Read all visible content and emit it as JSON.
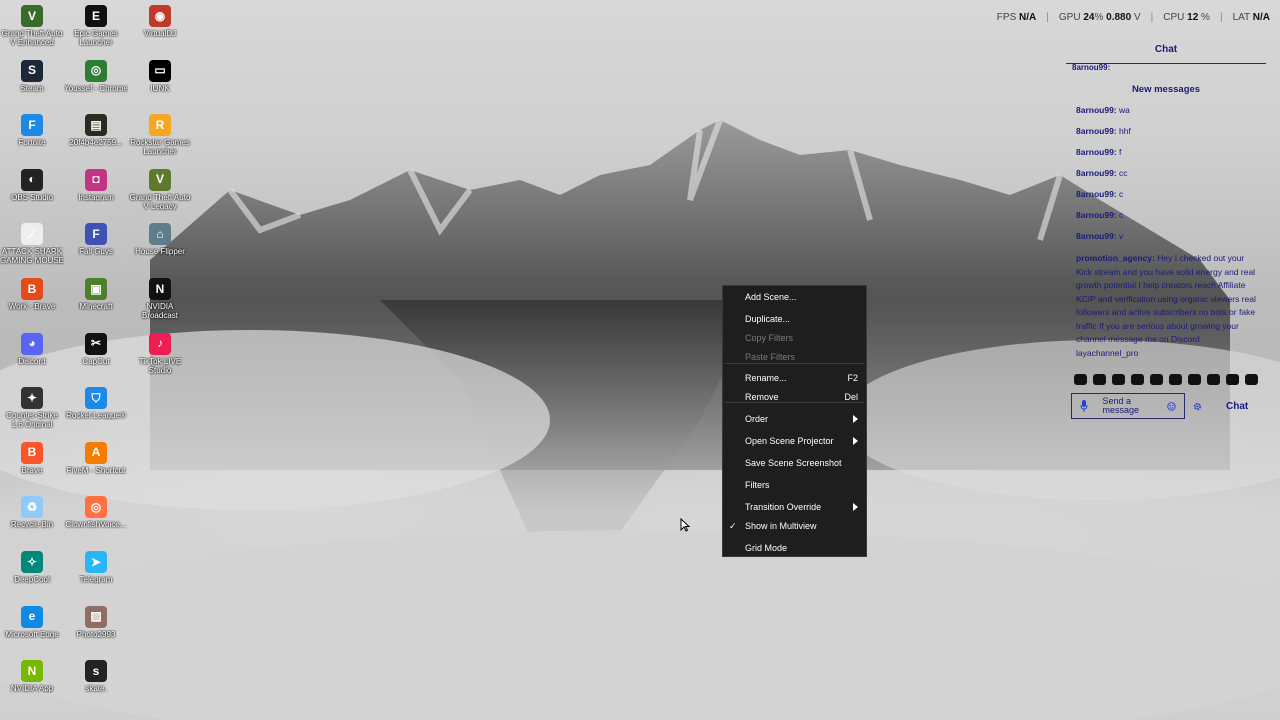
{
  "desktop_icons": [
    {
      "label": "Grand Theft Auto V Enhanced",
      "icon": "gta-icon",
      "color": "#3a6b2a",
      "glyph": "V"
    },
    {
      "label": "Epic Games Launcher",
      "icon": "epic-games-icon",
      "color": "#111111",
      "glyph": "E"
    },
    {
      "label": "VirtualDJ",
      "icon": "virtualdj-icon",
      "color": "#c0392b",
      "glyph": "◉"
    },
    {
      "label": "Steam",
      "icon": "steam-icon",
      "color": "#1b2838",
      "glyph": "S"
    },
    {
      "label": "Youssef - Chrome",
      "icon": "chrome-icon",
      "color": "#2e7d32",
      "glyph": "◎"
    },
    {
      "label": "IUNK",
      "icon": "monitor-icon",
      "color": "#000000",
      "glyph": "▭"
    },
    {
      "label": "Fortnite",
      "icon": "fortnite-icon",
      "color": "#1e88e5",
      "glyph": "F"
    },
    {
      "label": "20f4b4e2759...",
      "icon": "file-icon",
      "color": "#2b2b1f",
      "glyph": "▤"
    },
    {
      "label": "Rockstar Games Launcher",
      "icon": "rockstar-icon",
      "color": "#f5a623",
      "glyph": "R"
    },
    {
      "label": "OBS Studio",
      "icon": "obs-icon",
      "color": "#222222",
      "glyph": "◐"
    },
    {
      "label": "Instagram",
      "icon": "instagram-icon",
      "color": "#c13584",
      "glyph": "◘"
    },
    {
      "label": "Grand Theft Auto V Legacy",
      "icon": "gta-legacy-icon",
      "color": "#5d7a2d",
      "glyph": "V"
    },
    {
      "label": "ATTACK SHARK GAMING MOUSE",
      "icon": "mouse-icon",
      "color": "#eeeeee",
      "glyph": "⟋"
    },
    {
      "label": "Fall Guys",
      "icon": "fall-guys-icon",
      "color": "#3f51b5",
      "glyph": "F"
    },
    {
      "label": "House Flipper",
      "icon": "house-flipper-icon",
      "color": "#607d8b",
      "glyph": "⌂"
    },
    {
      "label": "Work - Brave",
      "icon": "brave-work-icon",
      "color": "#e64a19",
      "glyph": "B"
    },
    {
      "label": "Minecraft",
      "icon": "minecraft-icon",
      "color": "#4e7f2a",
      "glyph": "▣"
    },
    {
      "label": "NVIDIA Broadcast",
      "icon": "nvidia-broadcast-icon",
      "color": "#111111",
      "glyph": "N"
    },
    {
      "label": "Discord",
      "icon": "discord-icon",
      "color": "#5865f2",
      "glyph": "◕"
    },
    {
      "label": "CapCut",
      "icon": "capcut-icon",
      "color": "#111111",
      "glyph": "✂"
    },
    {
      "label": "TikTok LIVE Studio",
      "icon": "tiktok-icon",
      "color": "#ee1d52",
      "glyph": "♪"
    },
    {
      "label": "Counter-Strike 1.6 Original",
      "icon": "cs-icon",
      "color": "#333333",
      "glyph": "✦"
    },
    {
      "label": "Rocket League®",
      "icon": "rocket-league-icon",
      "color": "#1e88e5",
      "glyph": "⛉"
    },
    {
      "label": "Brave",
      "icon": "brave-icon",
      "color": "#fb542b",
      "glyph": "B"
    },
    {
      "label": "FiveM - Shortcut",
      "icon": "fivem-icon",
      "color": "#f57c00",
      "glyph": "A"
    },
    {
      "label": "Recycle Bin",
      "icon": "recycle-bin-icon",
      "color": "#90caf9",
      "glyph": "♻"
    },
    {
      "label": "ClownfishVoice...",
      "icon": "clownfish-icon",
      "color": "#ff7043",
      "glyph": "◎"
    },
    {
      "label": "DeepCool",
      "icon": "deepcool-icon",
      "color": "#00897b",
      "glyph": "✧"
    },
    {
      "label": "Telegram",
      "icon": "telegram-icon",
      "color": "#29b6f6",
      "glyph": "➤"
    },
    {
      "label": "Microsoft Edge",
      "icon": "edge-icon",
      "color": "#0c8ae4",
      "glyph": "e"
    },
    {
      "label": "Photo2993",
      "icon": "photo-icon",
      "color": "#8d6e63",
      "glyph": "▨"
    },
    {
      "label": "NVIDIA App",
      "icon": "nvidia-app-icon",
      "color": "#76b900",
      "glyph": "N"
    },
    {
      "label": "skate.",
      "icon": "skate-icon",
      "color": "#222222",
      "glyph": "s"
    }
  ],
  "perf": {
    "fps_label": "FPS",
    "fps_value": "N/A",
    "gpu_label": "GPU",
    "gpu_value": "24",
    "gpu_unit": "%",
    "gpu_volt": "0.880",
    "gpu_volt_unit": "V",
    "cpu_label": "CPU",
    "cpu_value": "12",
    "cpu_unit": "%",
    "lat_label": "LAT",
    "lat_value": "N/A"
  },
  "chat": {
    "title": "Chat",
    "top_user": "8arnou99:",
    "new_messages": "New messages",
    "messages": [
      {
        "user": "8arnou99:",
        "text": "wa"
      },
      {
        "user": "8arnou99:",
        "text": "hhf"
      },
      {
        "user": "8arnou99:",
        "text": "f"
      },
      {
        "user": "8arnou99:",
        "text": "cc"
      },
      {
        "user": "8arnou99:",
        "text": "c"
      },
      {
        "user": "8arnou99:",
        "text": "c"
      },
      {
        "user": "8arnou99:",
        "text": "v"
      }
    ],
    "promo": {
      "user": "promotion_agency:",
      "text": "Hey I checked out your Kick stream and you have solid energy and real growth potential I help creators reach Affiliate KCIP and verification using organic viewers real followers and active subscribers no bots or fake traffic If you are serious about growing your channel message me on Discord layachannel_pro"
    },
    "send_placeholder": "Send a message",
    "chat_button": "Chat"
  },
  "context_menu": {
    "items": [
      {
        "label": "Add Scene...",
        "state": "enabled"
      },
      {
        "label": "Duplicate...",
        "state": "enabled"
      },
      {
        "label": "Copy Filters",
        "state": "disabled"
      },
      {
        "label": "Paste Filters",
        "state": "disabled"
      },
      {
        "label": "Rename...",
        "state": "enabled",
        "shortcut": "F2"
      },
      {
        "label": "Remove",
        "state": "enabled",
        "shortcut": "Del"
      },
      {
        "label": "Order",
        "state": "enabled",
        "submenu": true
      },
      {
        "label": "Open Scene Projector",
        "state": "enabled",
        "submenu": true
      },
      {
        "label": "Save Scene Screenshot",
        "state": "enabled"
      },
      {
        "label": "Filters",
        "state": "enabled"
      },
      {
        "label": "Transition Override",
        "state": "enabled",
        "submenu": true
      },
      {
        "label": "Show in Multiview",
        "state": "enabled",
        "checked": true
      },
      {
        "label": "Grid Mode",
        "state": "enabled"
      }
    ]
  }
}
